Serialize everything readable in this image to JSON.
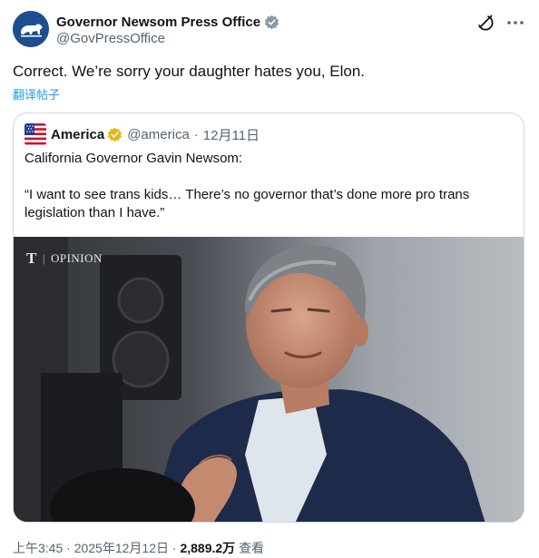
{
  "author": {
    "name": "Governor Newsom Press Office",
    "handle": "@GovPressOffice",
    "avatar_icon": "california-bear-icon",
    "badge_icon": "gray-verified-badge-icon",
    "badge_color": "#829aab"
  },
  "tweet": {
    "text": "Correct. We’re sorry your daughter hates you, Elon.",
    "translate_label": "翻译帖子"
  },
  "quoted": {
    "name": "America",
    "handle": "@america",
    "date": "12月11日",
    "badge_color": "#e2b719",
    "line1": "California Governor Gavin Newsom:",
    "line2": "“I want to see trans kids… There’s no governor that’s done more pro trans legislation than I have.”",
    "media": {
      "watermark_logo": "T",
      "watermark_label": "OPINION"
    }
  },
  "meta": {
    "time": "上午3:45",
    "date": "2025年12月12日",
    "views_count": "2,889.2万",
    "views_label": "查看",
    "separator": "·"
  },
  "colors": {
    "link": "#1d9bf0",
    "secondary_text": "#536471",
    "border": "#cfd9de"
  }
}
